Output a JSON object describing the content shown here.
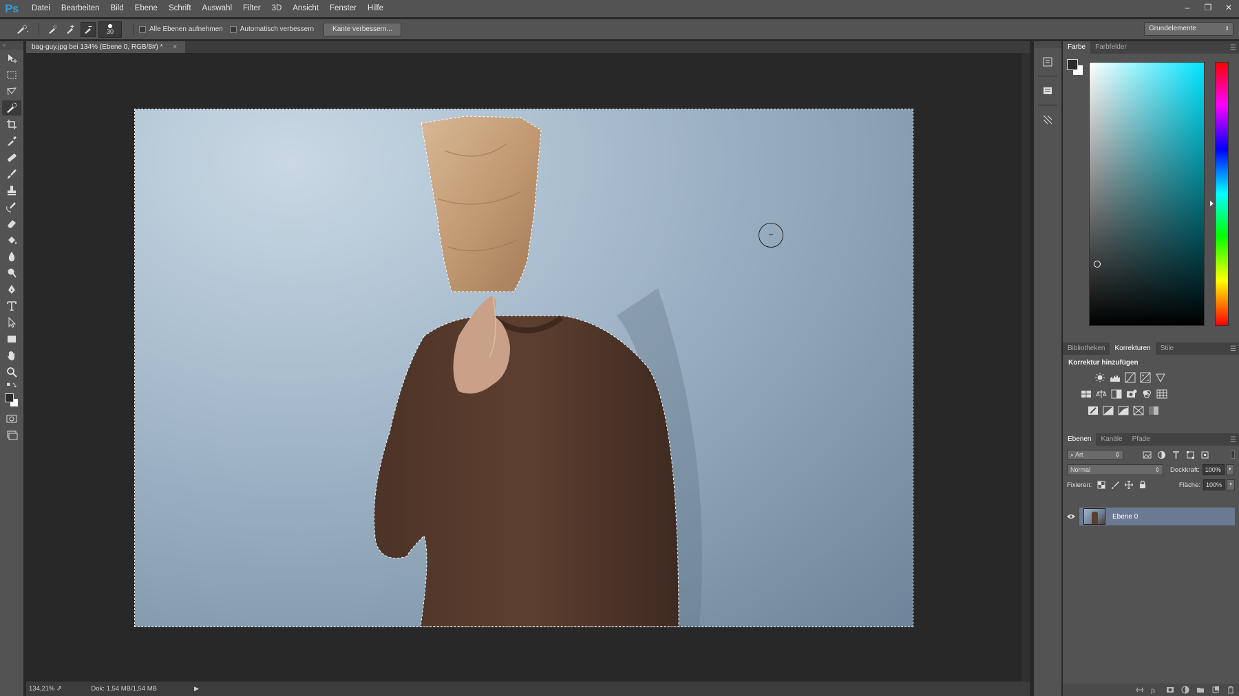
{
  "app": {
    "logo": "Ps"
  },
  "menu": [
    "Datei",
    "Bearbeiten",
    "Bild",
    "Ebene",
    "Schrift",
    "Auswahl",
    "Filter",
    "3D",
    "Ansicht",
    "Fenster",
    "Hilfe"
  ],
  "window_controls": {
    "minimize": "–",
    "restore": "❐",
    "close": "✕"
  },
  "options": {
    "brush_size": "30",
    "sample_all_layers_label": "Alle Ebenen aufnehmen",
    "auto_enhance_label": "Automatisch verbessern",
    "refine_edge_button": "Kante verbessern...",
    "workspace": "Grundelemente"
  },
  "document": {
    "tab_title": "bag-guy.jpg bei 134% (Ebene 0, RGB/8#) *",
    "tab_close": "×"
  },
  "status": {
    "zoom": "134,21%",
    "doc_info": "Dok: 1,54 MB/1,54 MB",
    "arrow": "▶"
  },
  "color_panel": {
    "tabs": [
      "Farbe",
      "Farbfelder"
    ],
    "active_tab": "Farbe",
    "menu": "☰",
    "fg_color": "#2b2b2b",
    "bg_color": "#ffffff"
  },
  "adjustments_panel": {
    "tabs": [
      "Bibliotheken",
      "Korrekturen",
      "Stile"
    ],
    "active_tab": "Korrekturen",
    "title": "Korrektur hinzufügen"
  },
  "layers_panel": {
    "tabs": [
      "Ebenen",
      "Kanäle",
      "Pfade"
    ],
    "active_tab": "Ebenen",
    "kind_filter": "Art",
    "blend_mode": "Normal",
    "opacity_label": "Deckkraft:",
    "opacity": "100%",
    "lock_label": "Fixieren:",
    "fill_label": "Fläche:",
    "fill": "100%",
    "layers": [
      {
        "name": "Ebene 0",
        "visible": true,
        "selected": true
      }
    ]
  },
  "colors": {
    "ui_bg": "#535353",
    "canvas_bg": "#282828",
    "accent_selected_layer": "#6b7a92",
    "ps_logo": "#2f9ed8"
  }
}
